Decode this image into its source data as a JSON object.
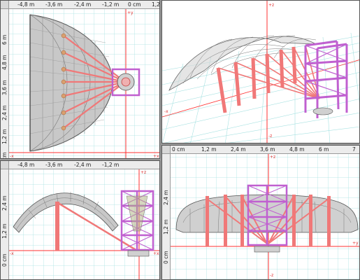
{
  "viewports": {
    "top": {
      "h_ticks": [
        "-4,8 m",
        "-3,6 m",
        "-2,4 m",
        "-1,2 m",
        "0 cm",
        "1,2"
      ],
      "v_ticks": [
        "6 m",
        "4,8 m",
        "3,6 m",
        "2,4 m",
        "1,2 m",
        "0 cm"
      ],
      "axis_labels": [
        "+y",
        "+x",
        "-x"
      ]
    },
    "perspective": {
      "axis_labels": [
        "+z",
        "-z",
        "-x"
      ]
    },
    "front": {
      "h_ticks": [
        "-4,8 m",
        "-3,6 m",
        "-2,4 m",
        "-1,2 m"
      ],
      "v_ticks": [
        "2,4 m",
        "1,2 m",
        "0 cm"
      ],
      "axis_labels": [
        "+z",
        "+x",
        "-x"
      ]
    },
    "side": {
      "h_ticks": [
        "0 cm",
        "1,2 m",
        "2,4 m",
        "3,6 m",
        "4,8 m",
        "6 m",
        "7"
      ],
      "v_ticks": [
        "2,4 m",
        "1,2 m",
        "0 cm"
      ],
      "axis_labels": [
        "+z",
        "+y",
        "-z"
      ]
    }
  },
  "colors": {
    "grid": "#a8e2e2",
    "axis": "#ff3030",
    "beam": "#f07878",
    "tower": "#c060d0",
    "shell": "#bdbdbd",
    "wire": "#606060"
  }
}
